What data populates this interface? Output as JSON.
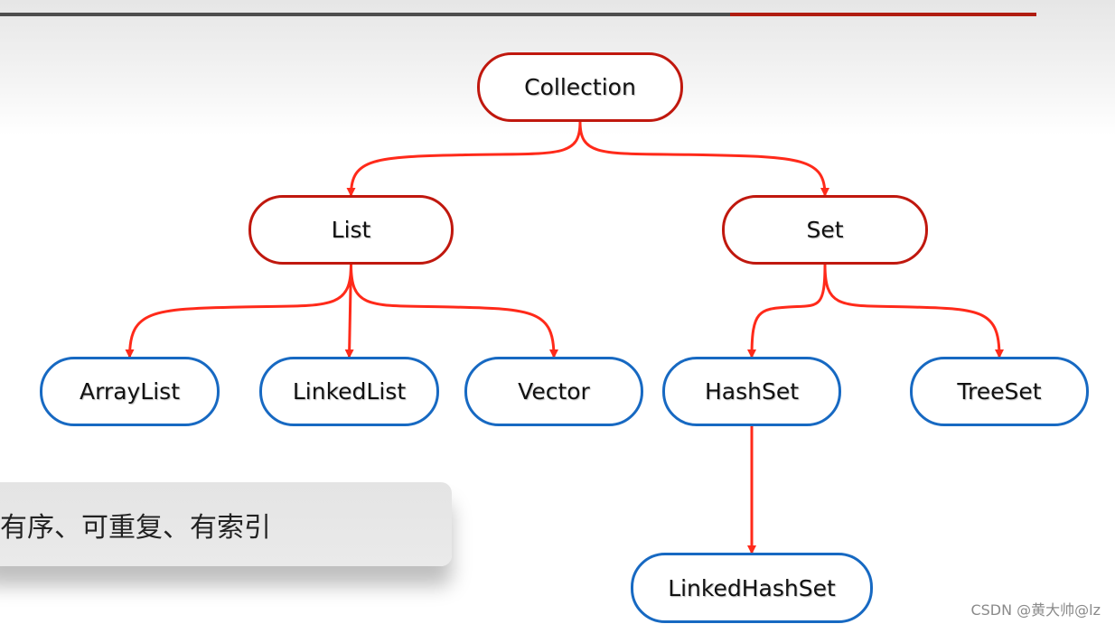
{
  "nodes": {
    "collection": "Collection",
    "list": "List",
    "set": "Set",
    "arraylist": "ArrayList",
    "linkedlist": "LinkedList",
    "vector": "Vector",
    "hashset": "HashSet",
    "treeset": "TreeSet",
    "linkedhashset": "LinkedHashSet"
  },
  "edges": [
    [
      "collection",
      "list"
    ],
    [
      "collection",
      "set"
    ],
    [
      "list",
      "arraylist"
    ],
    [
      "list",
      "linkedlist"
    ],
    [
      "list",
      "vector"
    ],
    [
      "set",
      "hashset"
    ],
    [
      "set",
      "treeset"
    ],
    [
      "hashset",
      "linkedhashset"
    ]
  ],
  "note": "有序、可重复、有索引",
  "watermark": "CSDN @黄大帅@lz",
  "colors": {
    "interface_border": "#c0180e",
    "class_border": "#1769c2",
    "arrow": "#ff2a1a"
  }
}
